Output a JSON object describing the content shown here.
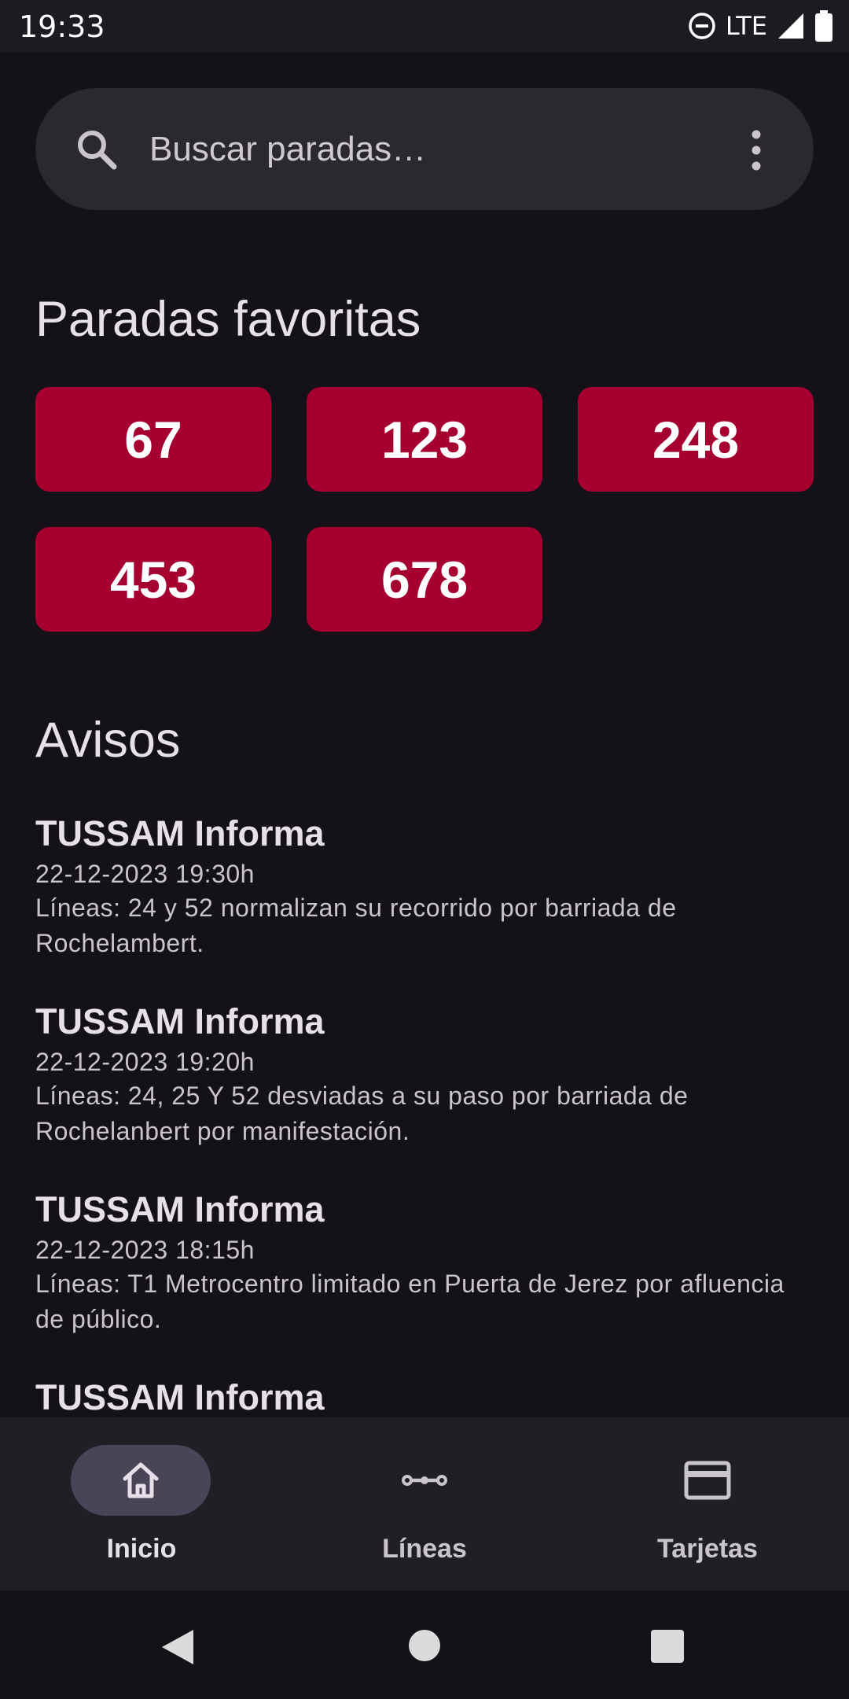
{
  "status_bar": {
    "time": "19:33",
    "network": "LTE",
    "icons": [
      "do-not-disturb-icon",
      "signal-icon",
      "battery-icon"
    ]
  },
  "search": {
    "placeholder": "Buscar paradas…",
    "icons": [
      "search-icon",
      "more-vert-icon"
    ]
  },
  "favorites": {
    "title": "Paradas favoritas",
    "stops": [
      "67",
      "123",
      "248",
      "453",
      "678"
    ]
  },
  "notices": {
    "title": "Avisos",
    "items": [
      {
        "source": "TUSSAM Informa",
        "time": "22-12-2023 19:30h",
        "text": "Líneas: 24 y 52 normalizan su recorrido por barriada de Rochelambert."
      },
      {
        "source": "TUSSAM Informa",
        "time": "22-12-2023 19:20h",
        "text": "Líneas: 24, 25 Y 52 desviadas a su paso por barriada de Rochelanbert por manifestación."
      },
      {
        "source": "TUSSAM Informa",
        "time": "22-12-2023 18:15h",
        "text": "Líneas: T1 Metrocentro limitado en Puerta de Jerez por afluencia de público."
      },
      {
        "source": "TUSSAM Informa",
        "time": "",
        "text": ""
      }
    ]
  },
  "bottom_nav": {
    "items": [
      {
        "label": "Inicio",
        "icon": "home-icon",
        "active": true
      },
      {
        "label": "Líneas",
        "icon": "route-icon",
        "active": false
      },
      {
        "label": "Tarjetas",
        "icon": "card-icon",
        "active": false
      }
    ]
  },
  "colors": {
    "background": "#141218",
    "accent": "#a5002f",
    "surface": "#2a2930",
    "nav_active_pill": "#4a4458"
  }
}
